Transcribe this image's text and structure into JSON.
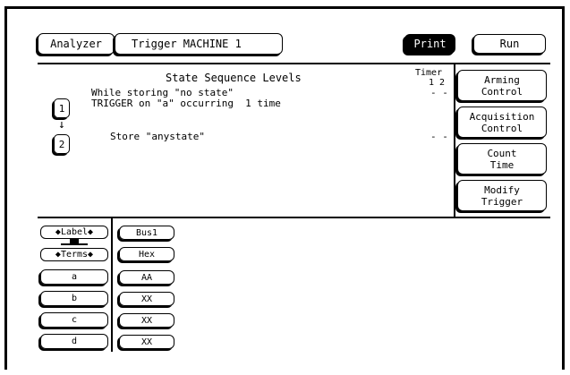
{
  "header": {
    "analyzer_label": "Analyzer",
    "trigger_label": "Trigger  MACHINE 1",
    "print_label": "Print",
    "run_label": "Run"
  },
  "sequence": {
    "title": "State Sequence Levels",
    "timer_label": "Timer",
    "timer_numbers": "1 2",
    "levels": [
      {
        "number": "1",
        "line1": "While storing \"no state\"",
        "line2": "TRIGGER on \"a\" occurring  1 time",
        "timer_value": "- -"
      },
      {
        "number": "2",
        "line1": "Store \"anystate\"",
        "timer_value": "- -"
      }
    ],
    "arrow": "↓"
  },
  "side_menu": {
    "arming_line1": "Arming",
    "arming_line2": "Control",
    "acquisition_line1": "Acquisition",
    "acquisition_line2": "Control",
    "count_line1": "Count",
    "count_line2": "Time",
    "modify_line1": "Modify",
    "modify_line2": "Trigger"
  },
  "terms": {
    "label_button": "◆Label◆",
    "terms_button": "◆Terms◆",
    "bus_label": "Bus1",
    "base_label": "Hex",
    "rows": [
      {
        "name": "a",
        "value": "AA"
      },
      {
        "name": "b",
        "value": "XX"
      },
      {
        "name": "c",
        "value": "XX"
      },
      {
        "name": "d",
        "value": "XX"
      }
    ]
  }
}
